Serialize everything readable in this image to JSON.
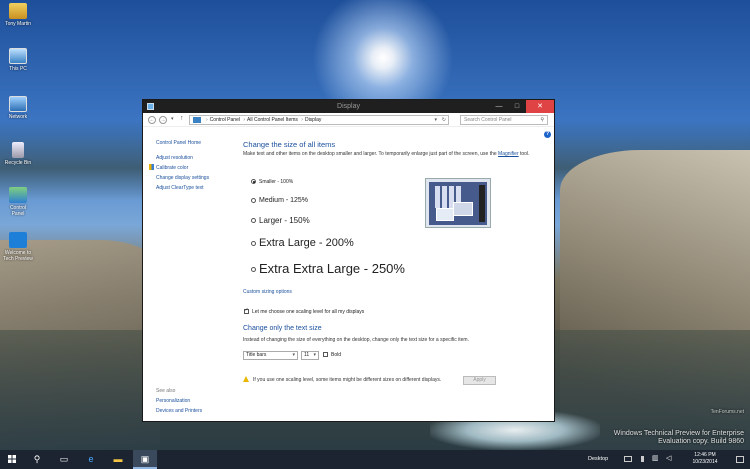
{
  "desktop": {
    "icons": [
      {
        "label": "Tony Martin",
        "icon": "user-folder-icon"
      },
      {
        "label": "This PC",
        "icon": "computer-icon"
      },
      {
        "label": "Network",
        "icon": "network-icon"
      },
      {
        "label": "Recycle Bin",
        "icon": "recycle-bin-icon"
      },
      {
        "label": "Control Panel",
        "icon": "control-panel-icon"
      },
      {
        "label": "Welcome to Tech Preview",
        "icon": "windows-logo-icon"
      }
    ],
    "watermark_line1": "Windows Technical Preview for Enterprise",
    "watermark_line2": "Evaluation copy. Build 9860",
    "site_watermark": "TenForums.net"
  },
  "window": {
    "title": "Display",
    "controls": {
      "minimize": "—",
      "maximize": "□",
      "close": "✕"
    },
    "address": {
      "segments": [
        "Control Panel",
        "All Control Panel Items",
        "Display"
      ],
      "search_placeholder": "Search Control Panel"
    },
    "sidebar": {
      "home": "Control Panel Home",
      "links": [
        "Adjust resolution",
        "Calibrate color",
        "Change display settings",
        "Adjust ClearType text"
      ],
      "see_also_label": "See also",
      "see_also": [
        "Personalization",
        "Devices and Printers"
      ]
    },
    "main": {
      "heading": "Change the size of all items",
      "description_part1": "Make text and other items on the desktop smaller and larger. To temporarily enlarge just part of the screen, use the ",
      "magnifier_link": "Magnifier",
      "description_part2": " tool.",
      "options": [
        {
          "label": "Smaller - 100%",
          "selected": true
        },
        {
          "label": "Medium - 125%",
          "selected": false
        },
        {
          "label": "Larger - 150%",
          "selected": false
        },
        {
          "label": "Extra Large - 200%",
          "selected": false
        },
        {
          "label": "Extra Extra Large - 250%",
          "selected": false
        }
      ],
      "custom_link": "Custom sizing options",
      "checkbox_label": "Let me choose one scaling level for all my displays",
      "checkbox_checked": true,
      "text_heading": "Change only the text size",
      "text_description": "Instead of changing the size of everything on the desktop, change only the text size for a specific item.",
      "item_select": "Title bars",
      "size_select": "11",
      "bold_label": "Bold",
      "warning": "If you use one scaling level, some items might be different sizes on different displays.",
      "apply_label": "Apply"
    }
  },
  "taskbar": {
    "desktop_label": "Desktop",
    "time": "12:46 PM",
    "date": "10/23/2014"
  }
}
